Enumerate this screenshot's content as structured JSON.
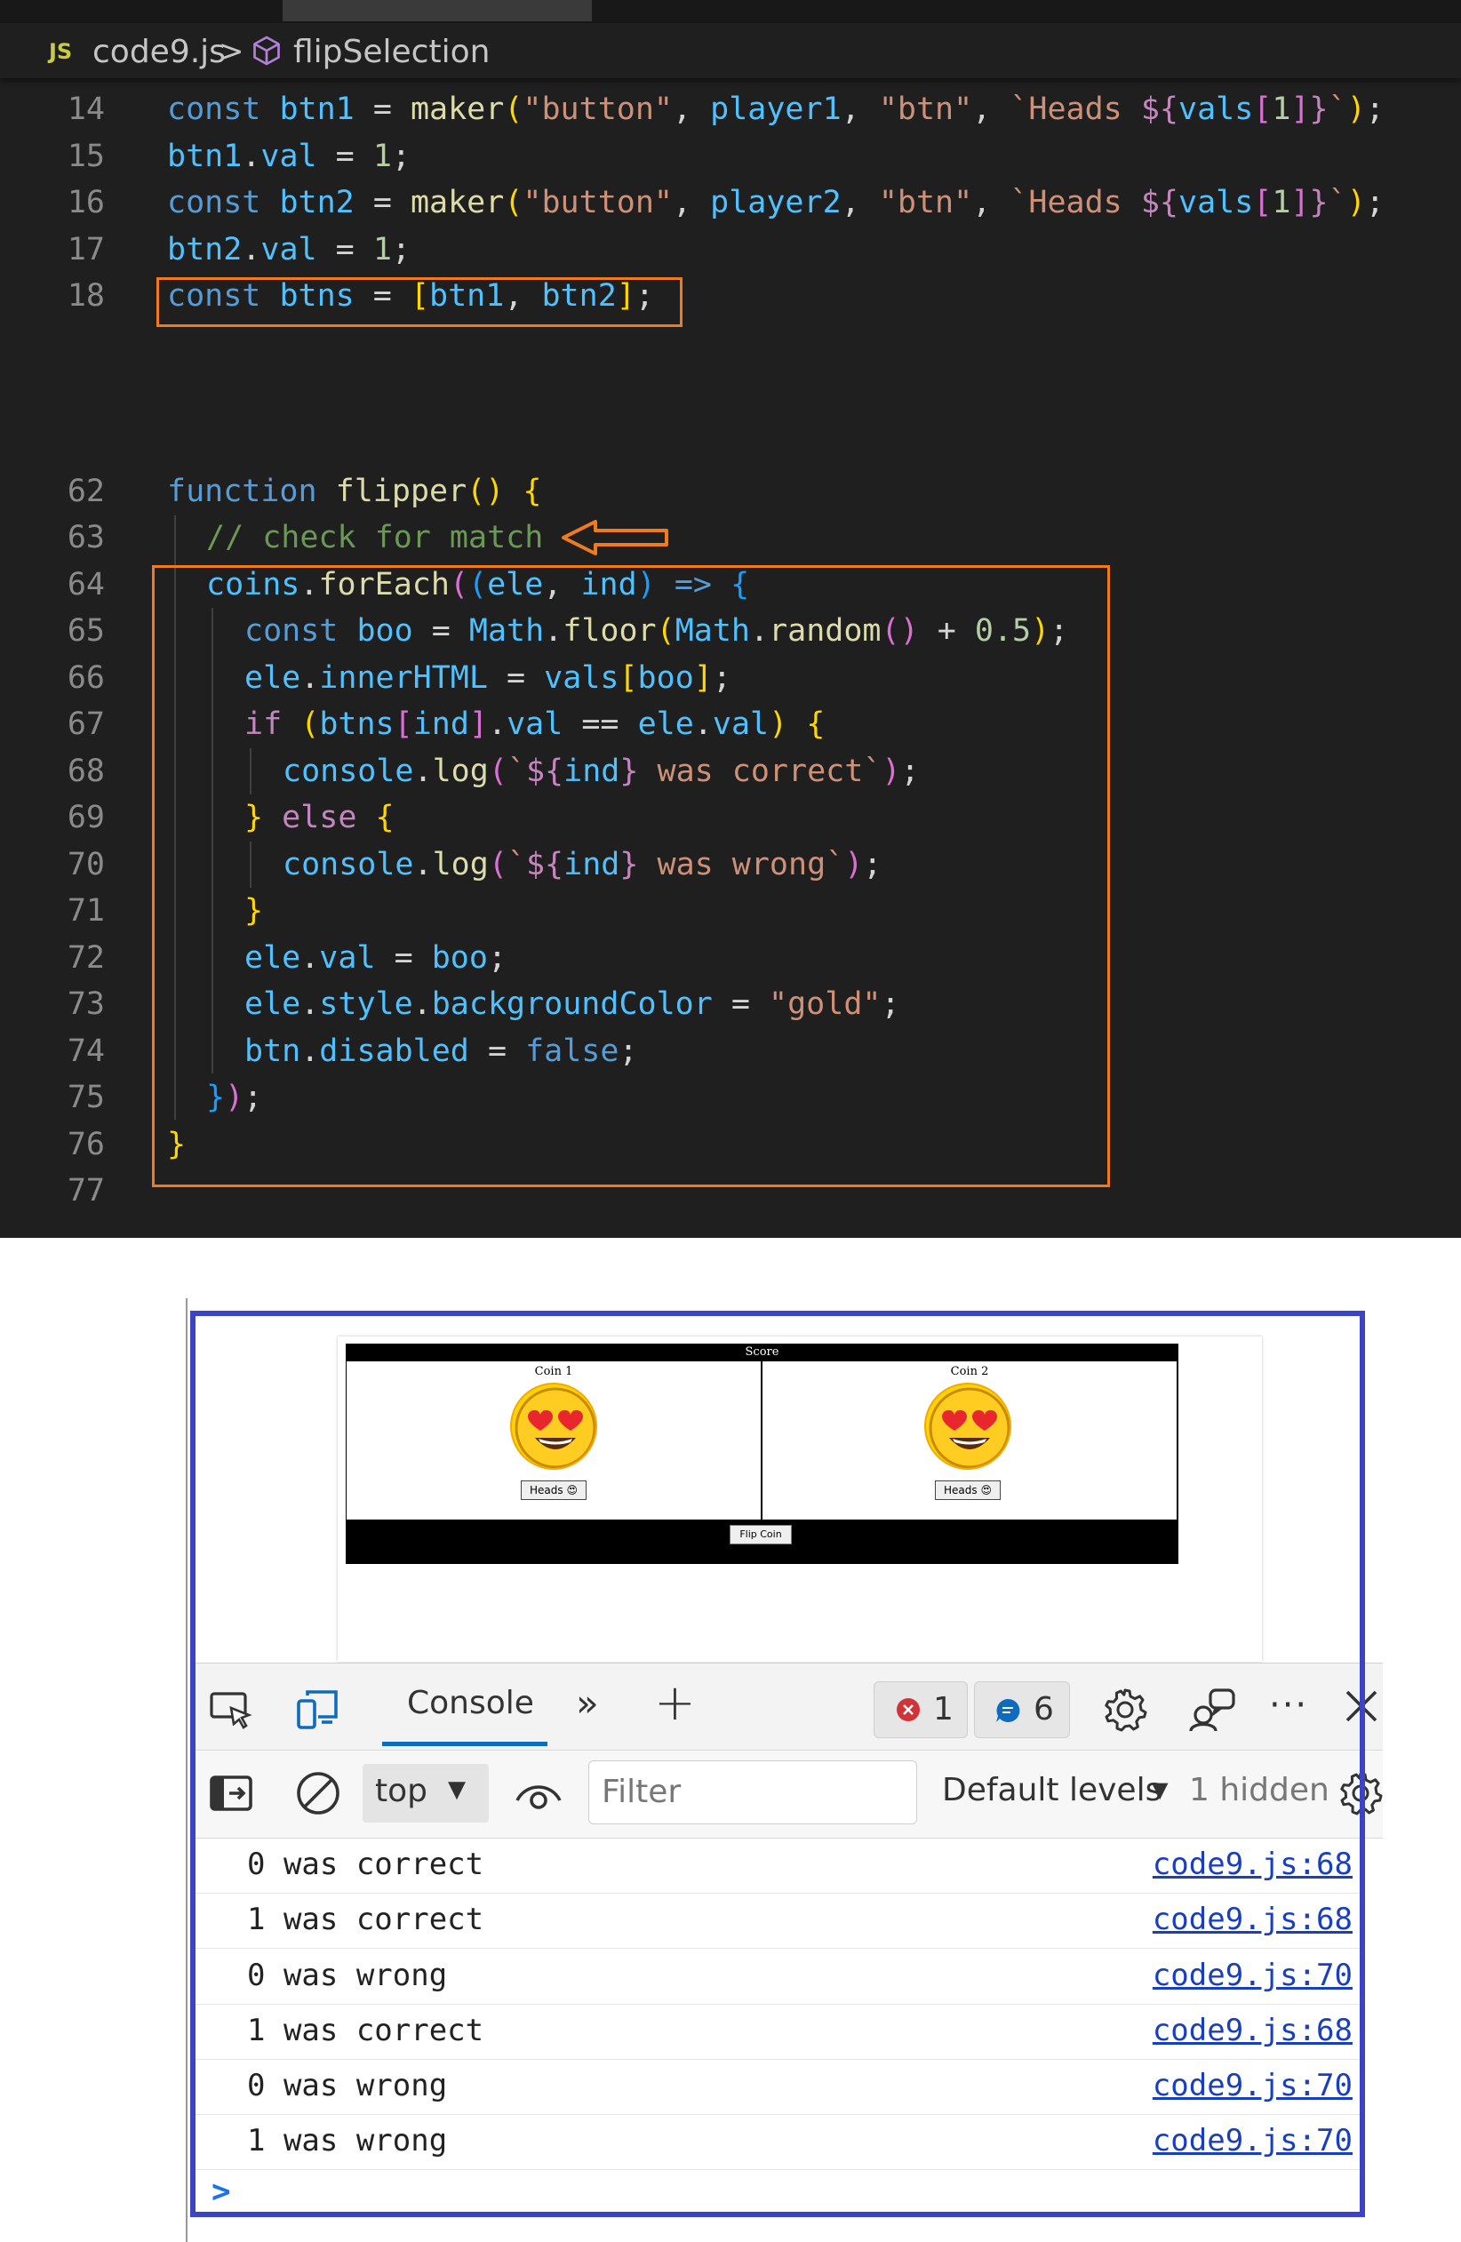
{
  "editor": {
    "breadcrumb": {
      "lang_badge": "JS",
      "file": "code9.js",
      "separator": ">",
      "symbol": "flipSelection"
    },
    "line_numbers": [
      "14",
      "15",
      "16",
      "17",
      "18",
      "62",
      "63",
      "64",
      "65",
      "66",
      "67",
      "68",
      "69",
      "70",
      "71",
      "72",
      "73",
      "74",
      "75",
      "76",
      "77"
    ],
    "lines": [
      "const btn1 = maker(\"button\", player1, \"btn\", `Heads ${vals[1]}`);",
      "btn1.val = 1;",
      "const btn2 = maker(\"button\", player2, \"btn\", `Heads ${vals[1]}`);",
      "btn2.val = 1;",
      "const btns = [btn1, btn2];",
      "function flipper() {",
      "// check for match",
      "coins.forEach((ele, ind) => {",
      "const boo = Math.floor(Math.random() + 0.5);",
      "ele.innerHTML = vals[boo];",
      "if (btns[ind].val == ele.val) {",
      "console.log(`${ind} was correct`);",
      "} else {",
      "console.log(`${ind} was wrong`);",
      "}",
      "ele.val = boo;",
      "ele.style.backgroundColor = \"gold\";",
      "btn.disabled = false;",
      "});",
      "}",
      ""
    ],
    "highlight_color": "#f07a1c"
  },
  "browser_page": {
    "score_label": "Score",
    "coin1_title": "Coin 1",
    "coin2_title": "Coin 2",
    "coin_face": "😍",
    "coin1_button": "Heads 😍",
    "coin2_button": "Heads 😍",
    "flip_button": "Flip Coin"
  },
  "devtools": {
    "tab_console": "Console",
    "error_count": "1",
    "message_count": "6",
    "context": "top",
    "filter_placeholder": "Filter",
    "levels": "Default levels",
    "hidden": "1 hidden",
    "prompt": ">",
    "icons": [
      "inspect-icon",
      "device-toggle-icon",
      "more-tabs-icon",
      "add-tab-icon",
      "error-icon",
      "message-icon",
      "settings-icon",
      "feedback-icon",
      "more-icon",
      "close-icon",
      "sidebar-icon",
      "clear-icon",
      "dropdown-icon",
      "eye-icon",
      "levels-dropdown-icon",
      "console-settings-icon"
    ]
  },
  "console_logs": [
    {
      "message": "0 was correct",
      "source": "code9.js:68"
    },
    {
      "message": "1 was correct",
      "source": "code9.js:68"
    },
    {
      "message": "0 was wrong",
      "source": "code9.js:70"
    },
    {
      "message": "1 was correct",
      "source": "code9.js:68"
    },
    {
      "message": "0 was wrong",
      "source": "code9.js:70"
    },
    {
      "message": "1 was wrong",
      "source": "code9.js:70"
    }
  ],
  "colors": {
    "frame": "#3b44c6",
    "error": "#d13438",
    "message": "#0f6cbd",
    "link": "#1a3fbd"
  }
}
